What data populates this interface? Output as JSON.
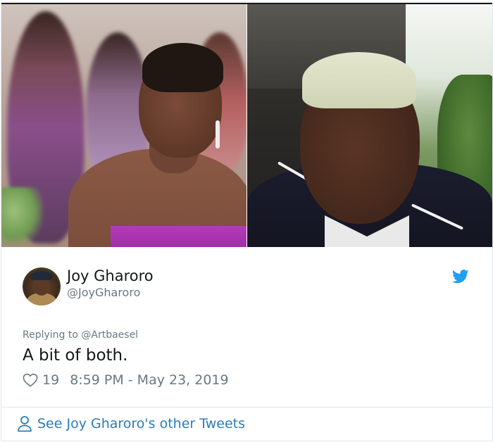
{
  "tweet": {
    "author": {
      "display_name": "Joy Gharoro",
      "handle": "@JoyGharoro"
    },
    "replying_to": "Replying to @Artbaesel",
    "text": "A bit of both.",
    "likes": "19",
    "timestamp": "8:59 PM - May 23, 2019"
  },
  "footer": {
    "cta": "See Joy Gharoro's other Tweets"
  },
  "icons": {
    "bird": "twitter-bird-icon",
    "heart": "heart-icon",
    "person": "person-icon"
  },
  "colors": {
    "twitter_blue": "#1da1f2",
    "link_blue": "#2b7bb9",
    "muted_text": "#697882",
    "text": "#14171a",
    "border": "#e1e8ed"
  }
}
